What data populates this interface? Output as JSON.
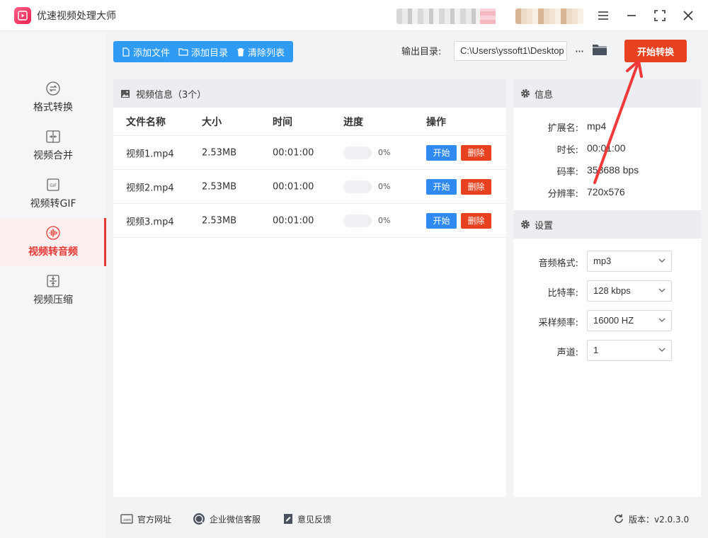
{
  "app": {
    "title": "优速视频处理大师"
  },
  "sidebar": {
    "items": [
      {
        "label": "格式转换",
        "icon": "swap-icon",
        "active": false
      },
      {
        "label": "视频合并",
        "icon": "merge-icon",
        "active": false
      },
      {
        "label": "视频转GIF",
        "icon": "gif-icon",
        "active": false
      },
      {
        "label": "视频转音频",
        "icon": "audio-wave-icon",
        "active": true
      },
      {
        "label": "视频压缩",
        "icon": "compress-icon",
        "active": false
      }
    ]
  },
  "toolbar": {
    "add_file": "添加文件",
    "add_dir": "添加目录",
    "clear_list": "清除列表",
    "output_label": "输出目录:",
    "output_path": "C:\\Users\\yssoft1\\Desktop",
    "more": "···",
    "start_all": "开始转换"
  },
  "file_panel": {
    "title": "视频信息（3个）",
    "columns": [
      "文件名称",
      "大小",
      "时间",
      "进度",
      "操作"
    ],
    "rows": [
      {
        "name": "视频1.mp4",
        "size": "2.53MB",
        "time": "00:01:00",
        "progress": 0,
        "progress_text": "0%",
        "start": "开始",
        "delete": "删除"
      },
      {
        "name": "视频2.mp4",
        "size": "2.53MB",
        "time": "00:01:00",
        "progress": 0,
        "progress_text": "0%",
        "start": "开始",
        "delete": "删除"
      },
      {
        "name": "视频3.mp4",
        "size": "2.53MB",
        "time": "00:01:00",
        "progress": 0,
        "progress_text": "0%",
        "start": "开始",
        "delete": "删除"
      }
    ]
  },
  "info_panel": {
    "title": "信息",
    "items": [
      {
        "key": "扩展名:",
        "value": "mp4"
      },
      {
        "key": "时长:",
        "value": "00:01:00"
      },
      {
        "key": "码率:",
        "value": "353688 bps"
      },
      {
        "key": "分辨率:",
        "value": "720x576"
      }
    ]
  },
  "settings_panel": {
    "title": "设置",
    "items": [
      {
        "key": "音频格式:",
        "value": "mp3"
      },
      {
        "key": "比特率:",
        "value": "128 kbps"
      },
      {
        "key": "采样频率:",
        "value": "16000 HZ"
      },
      {
        "key": "声道:",
        "value": "1"
      }
    ]
  },
  "footer": {
    "website": "官方网址",
    "wechat": "企业微信客服",
    "feedback": "意见反馈",
    "version": "版本：v2.0.3.0"
  },
  "colors": {
    "accent_blue": "#2f9bf3",
    "accent_red": "#e8411f",
    "active_red": "#e53935"
  }
}
